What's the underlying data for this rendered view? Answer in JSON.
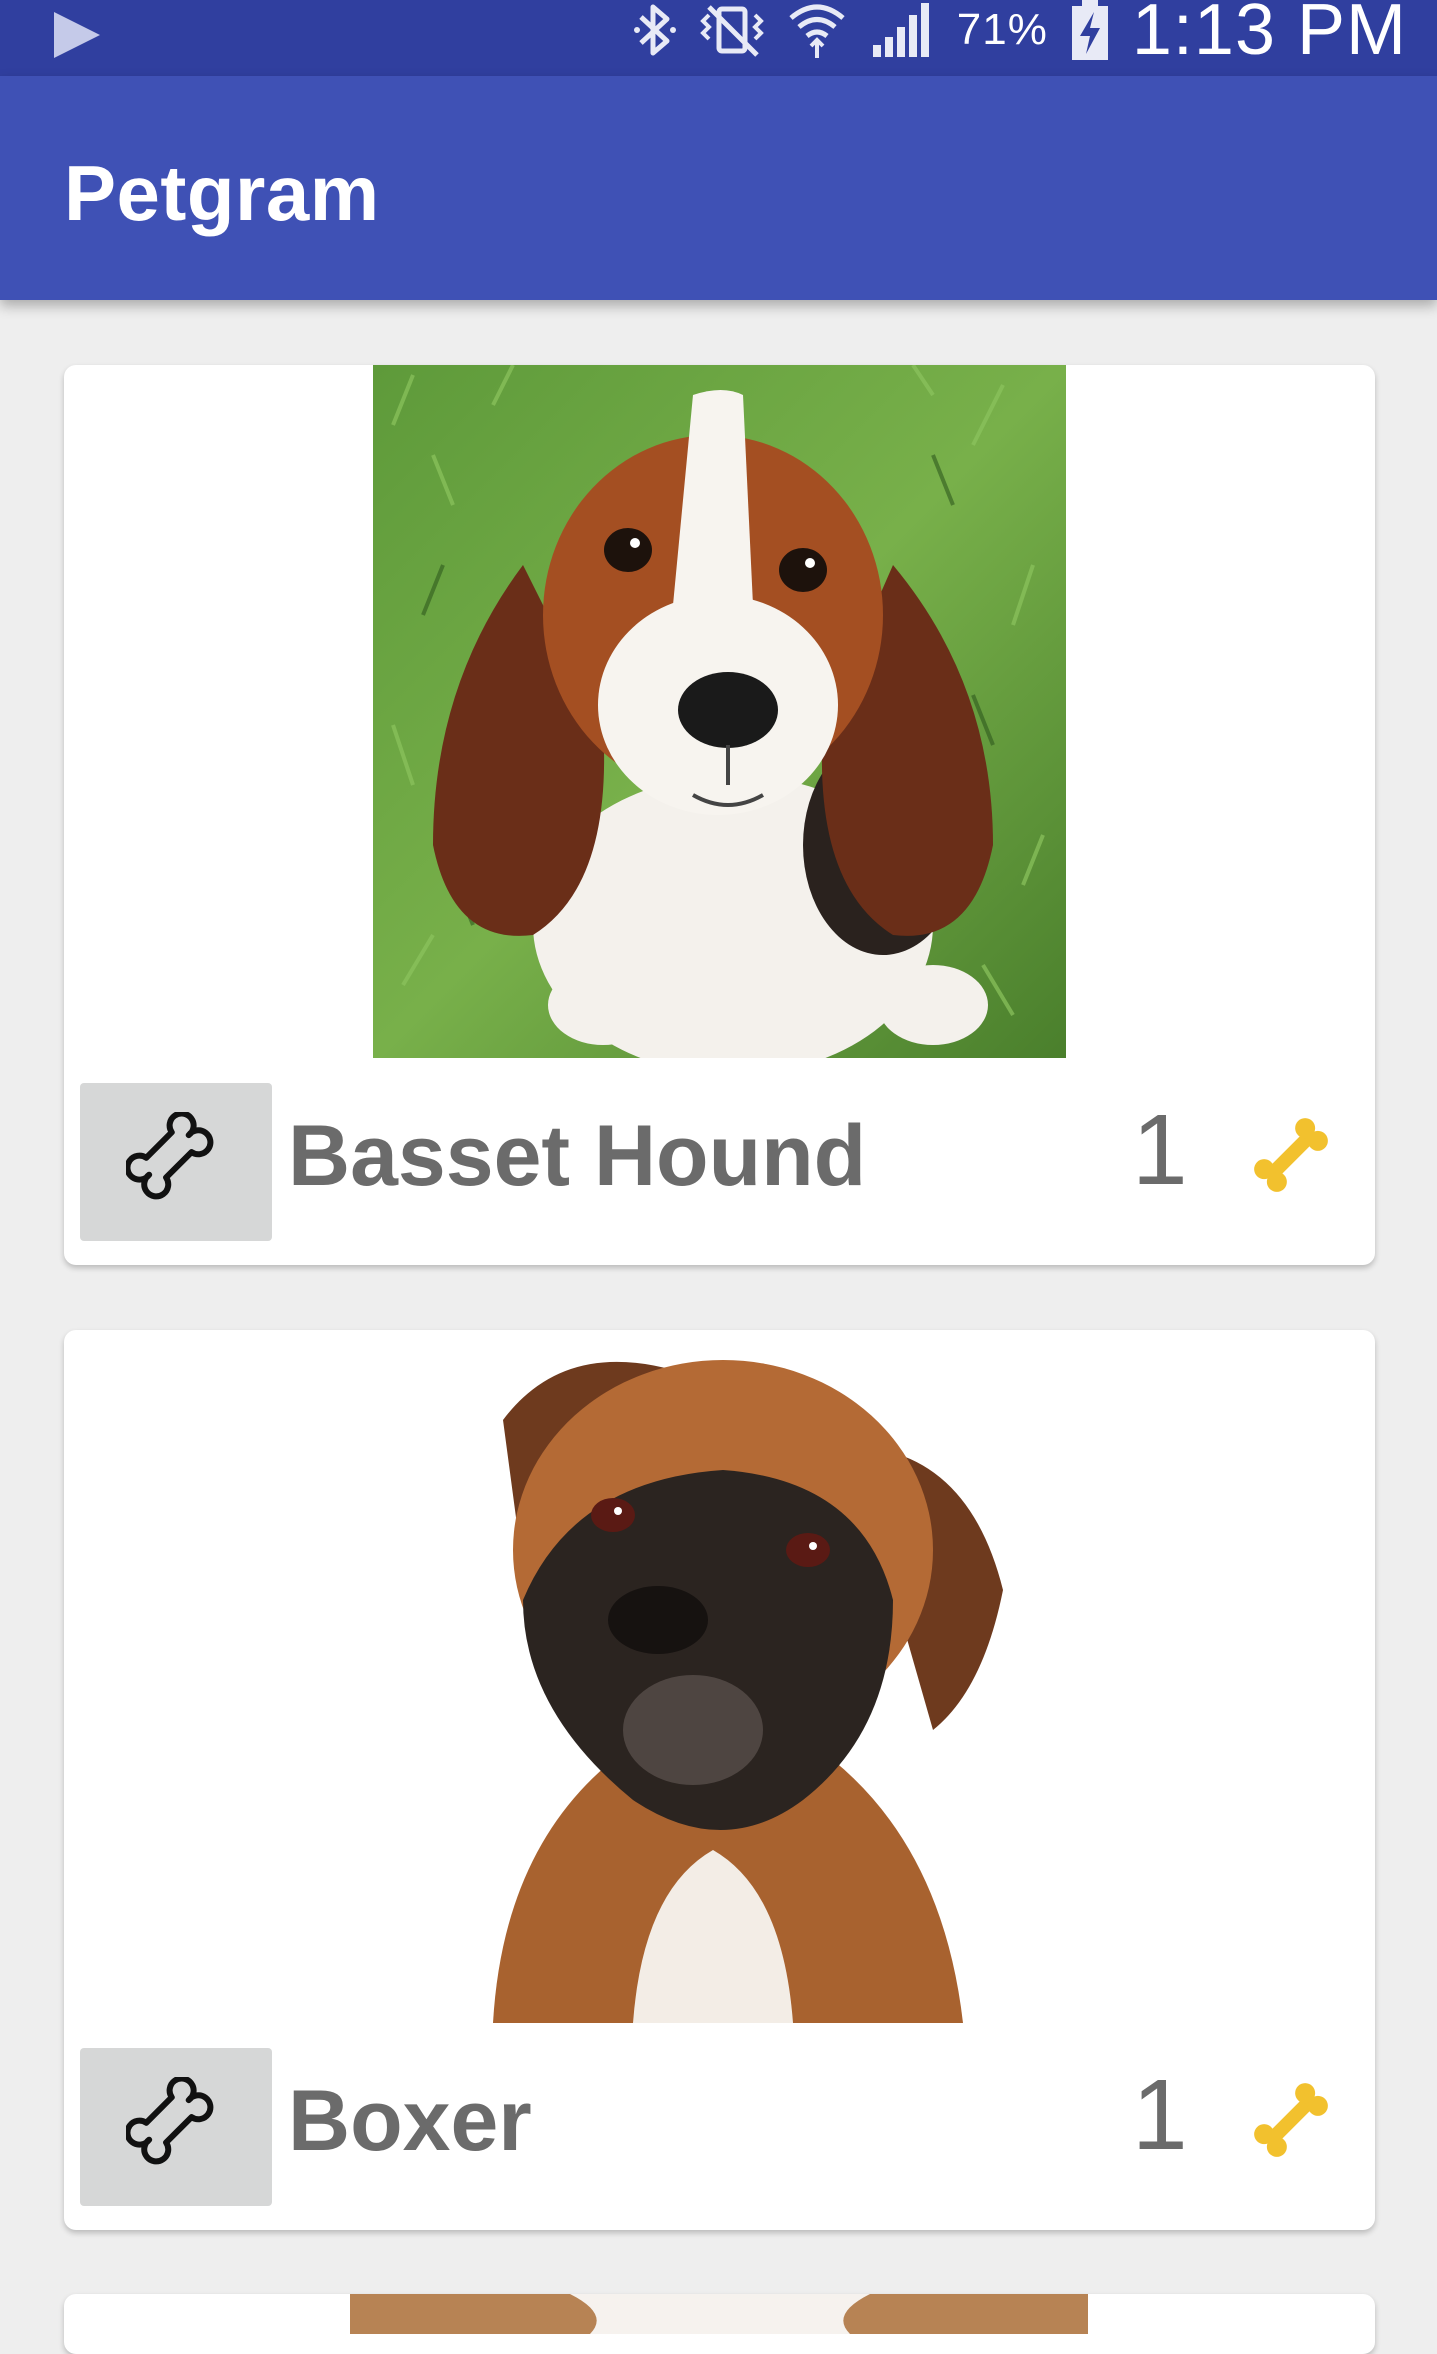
{
  "status_bar": {
    "battery_percent": "71%",
    "time": "1:13 PM",
    "icons": [
      "play-store-icon",
      "bluetooth-icon",
      "vibrate-icon",
      "wifi-icon",
      "signal-icon",
      "battery-charging-icon"
    ]
  },
  "app_bar": {
    "title": "Petgram"
  },
  "colors": {
    "status_bar": "#303f9f",
    "app_bar": "#3f51b5",
    "background": "#eeeeee",
    "card": "#ffffff",
    "like_button": "#d6d7d7",
    "text_gray": "#6b6b6b",
    "bone_gold": "#f2c12e"
  },
  "pets": [
    {
      "name": "Basset Hound",
      "likes": "1",
      "photo": "basset-hound-photo"
    },
    {
      "name": "Boxer",
      "likes": "1",
      "photo": "boxer-photo"
    }
  ]
}
